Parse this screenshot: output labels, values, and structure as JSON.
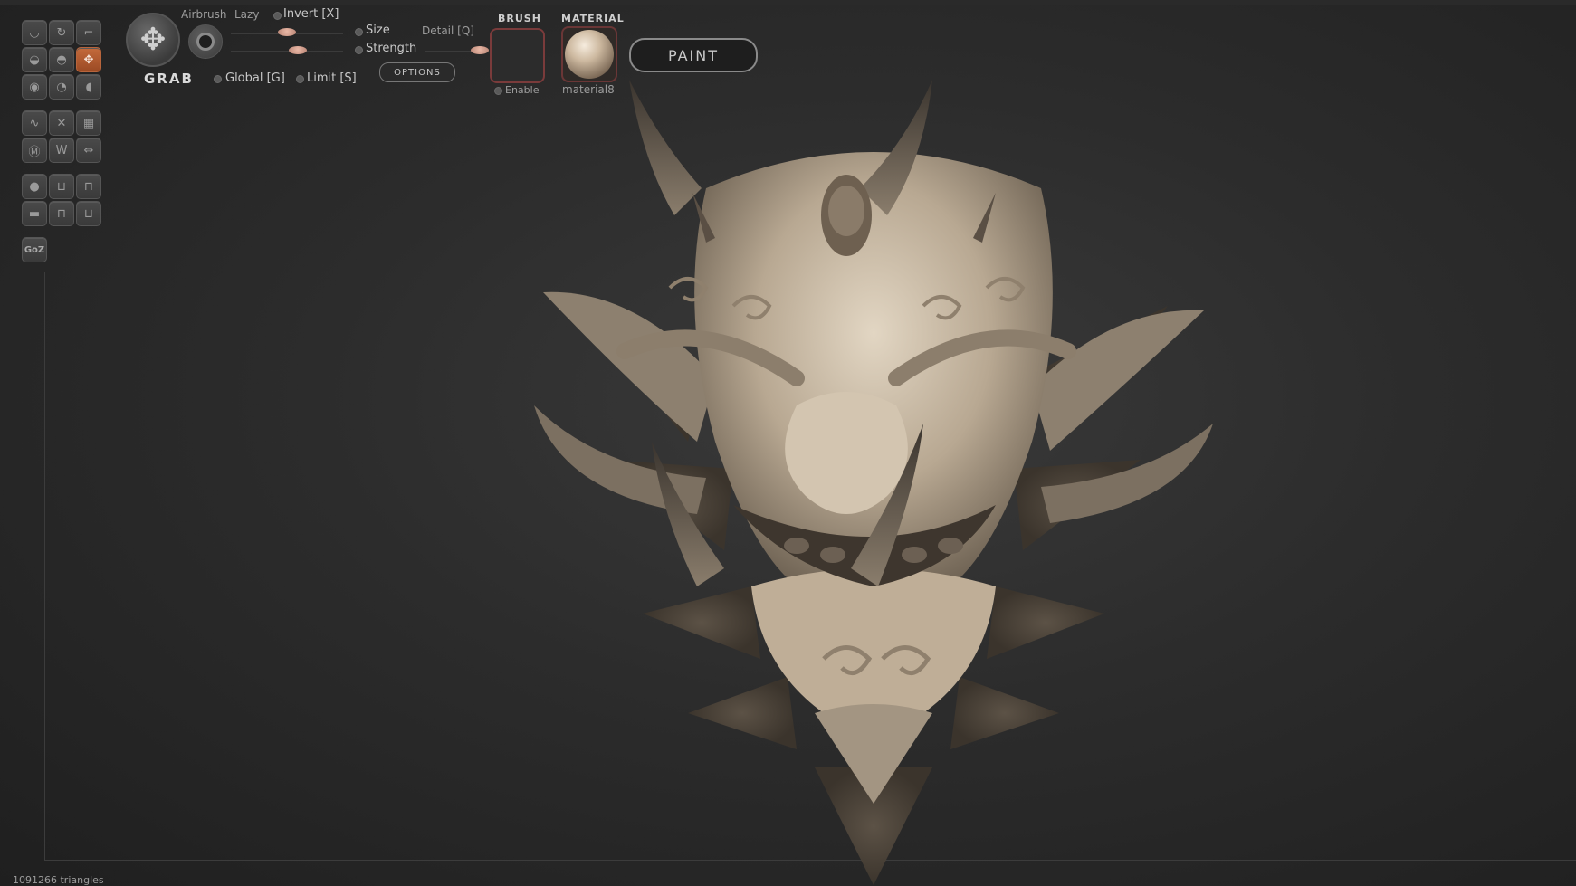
{
  "brush": {
    "name": "GRAB",
    "airbrush_label": "Airbrush",
    "lazy_label": "Lazy",
    "invert_label": "Invert [X]",
    "size_label": "Size",
    "detail_label": "Detail [Q]",
    "strength_label": "Strength",
    "global_label": "Global [G]",
    "limit_label": "Limit [S]",
    "options_label": "OPTIONS",
    "size_value": 0.5,
    "strength_value": 0.6,
    "detail_value": 1.0
  },
  "panel": {
    "brush_title": "BRUSH",
    "material_title": "MATERIAL",
    "enable_label": "Enable",
    "material_name": "material8",
    "paint_label": "PAINT"
  },
  "tools": {
    "goz_label": "GoZ",
    "active_tool": "grab",
    "icons": [
      "clay-icon",
      "rotate-icon",
      "crop-icon",
      "inflate-icon",
      "smooth-icon",
      "grab-icon",
      "pinch-icon",
      "blob-icon",
      "flatten-icon",
      "curve-icon",
      "knife-icon",
      "mask-icon",
      "smear-icon",
      "crease-icon",
      "move-icon",
      "sphere-icon",
      "symmetry-x-icon",
      "symmetry-y-icon",
      "plane-icon",
      "lock-icon",
      "unlock-icon"
    ]
  },
  "status": {
    "triangles": "1091266 triangles"
  },
  "colors": {
    "accent": "#c46a3b",
    "model": "#cdbfa9",
    "background": "#2c2c2c"
  }
}
